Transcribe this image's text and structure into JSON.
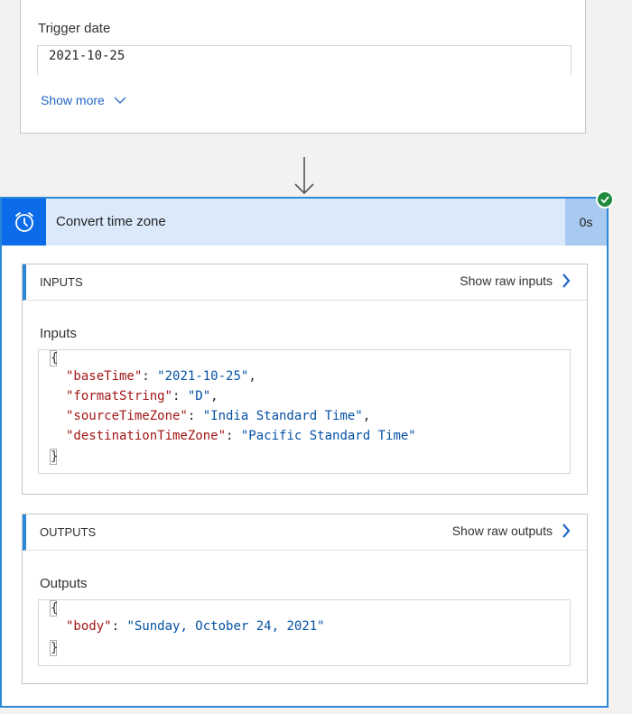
{
  "previous_card": {
    "field_label": "Trigger date",
    "field_value": "2021-10-25",
    "show_more_label": "Show more"
  },
  "action_card": {
    "title": "Convert time zone",
    "duration": "0s",
    "icon": "alarm-clock-icon",
    "status_icon": "success-check-icon",
    "accent_color": "#0b6be8",
    "header_color": "#dbeafb"
  },
  "inputs_section": {
    "title": "INPUTS",
    "raw_link_label": "Show raw inputs",
    "subheading": "Inputs",
    "json": {
      "open": "{",
      "close": "}",
      "lines": [
        {
          "key": "\"baseTime\"",
          "value": "\"2021-10-25\"",
          "trail": ","
        },
        {
          "key": "\"formatString\"",
          "value": "\"D\"",
          "trail": ","
        },
        {
          "key": "\"sourceTimeZone\"",
          "value": "\"India Standard Time\"",
          "trail": ","
        },
        {
          "key": "\"destinationTimeZone\"",
          "value": "\"Pacific Standard Time\"",
          "trail": ""
        }
      ]
    }
  },
  "outputs_section": {
    "title": "OUTPUTS",
    "raw_link_label": "Show raw outputs",
    "subheading": "Outputs",
    "json": {
      "open": "{",
      "close": "}",
      "lines": [
        {
          "key": "\"body\"",
          "value": "\"Sunday, October 24, 2021\"",
          "trail": ""
        }
      ]
    }
  }
}
